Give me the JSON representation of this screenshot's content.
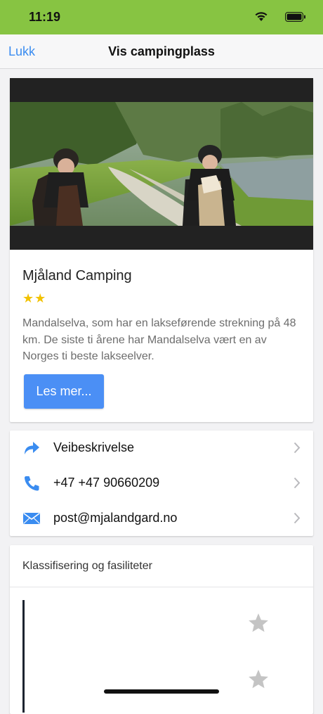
{
  "status_bar": {
    "time": "11:19",
    "background": "#87c442"
  },
  "nav": {
    "close_label": "Lukk",
    "title": "Vis campingplass"
  },
  "camp": {
    "name": "Mjåland Camping",
    "rating_stars": "★★",
    "rating_value": 2,
    "description": "Mandalselva, som har en lakseførende strekning på 48 km. De siste ti årene har Mandalselva vært en av Norges ti beste lakseelver.",
    "read_more_label": "Les mer..."
  },
  "contact": {
    "items": [
      {
        "icon": "directions-arrow-icon",
        "label": "Veibeskrivelse"
      },
      {
        "icon": "phone-icon",
        "label": "+47 +47 90660209"
      },
      {
        "icon": "mail-icon",
        "label": "post@mjalandgard.no"
      }
    ]
  },
  "facilities": {
    "title": "Klassifisering og fasiliteter"
  },
  "colors": {
    "accent": "#4b8ff5",
    "link": "#3a8cf0",
    "star": "#f2c200"
  }
}
